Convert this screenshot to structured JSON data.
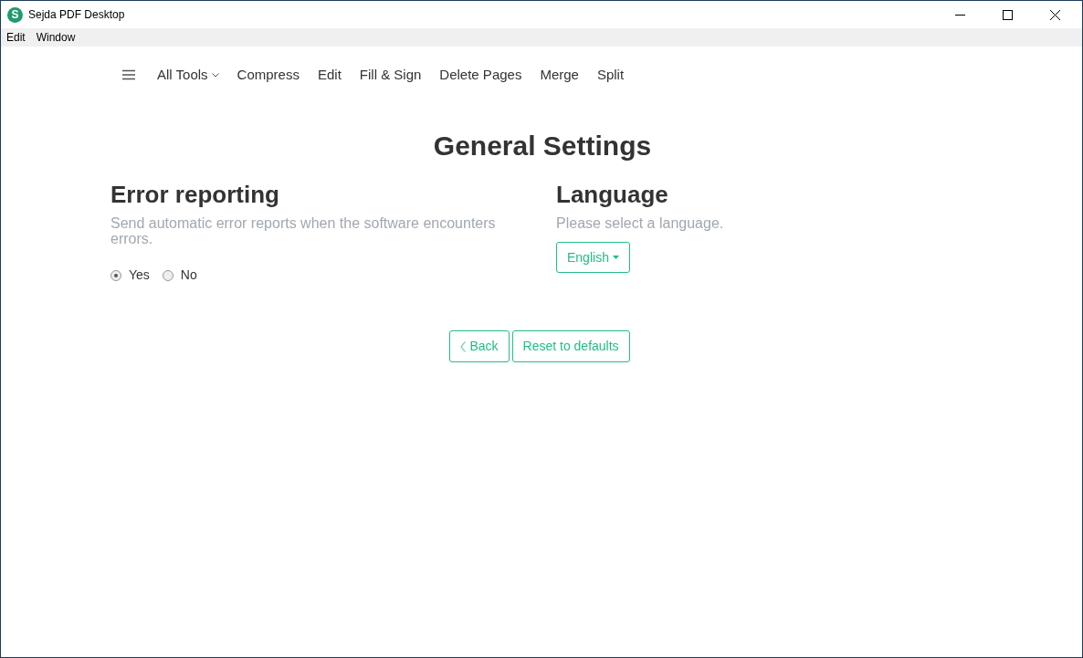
{
  "window": {
    "title": "Sejda PDF Desktop",
    "logo_letter": "S"
  },
  "menu_bar": [
    "Edit",
    "Window"
  ],
  "nav": {
    "items": [
      {
        "label": "All Tools",
        "kind": "dropdown"
      },
      {
        "label": "Compress",
        "kind": "link"
      },
      {
        "label": "Edit",
        "kind": "link"
      },
      {
        "label": "Fill & Sign",
        "kind": "link"
      },
      {
        "label": "Delete Pages",
        "kind": "link"
      },
      {
        "label": "Merge",
        "kind": "link"
      },
      {
        "label": "Split",
        "kind": "link"
      }
    ]
  },
  "page_title": "General Settings",
  "error_reporting": {
    "heading": "Error reporting",
    "description": "Send automatic error reports when the software encounters errors.",
    "options": [
      {
        "label": "Yes",
        "selected": true
      },
      {
        "label": "No",
        "selected": false
      }
    ]
  },
  "language": {
    "heading": "Language",
    "description": "Please select a language.",
    "value": "English"
  },
  "buttons": [
    {
      "label": "Back",
      "kind": "back"
    },
    {
      "label": "Reset to defaults",
      "kind": "plain"
    }
  ]
}
